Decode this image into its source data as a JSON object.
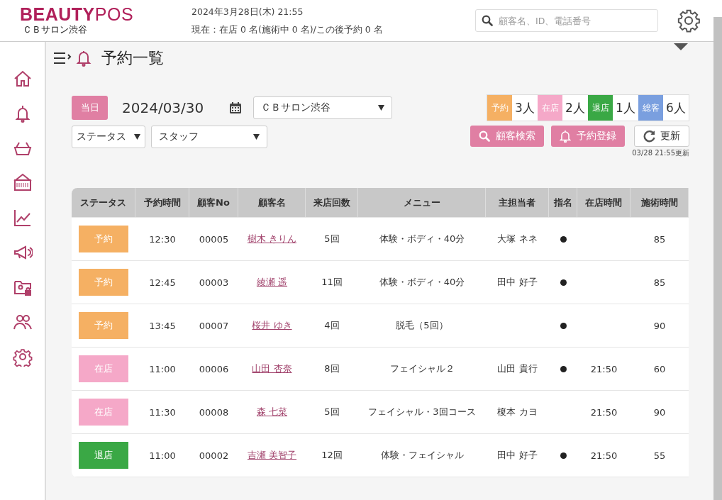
{
  "header": {
    "logo_bold": "BEAUTY",
    "logo_light": "POS",
    "salon": "ＣＢサロン渋谷",
    "datetime": "2024年3月28日(木) 21:55",
    "current": "現在：在店 0 名(施術中 0 名)/この後予約 0 名",
    "search": {
      "placeholder": "顧客名、ID、電話番号"
    }
  },
  "page_title": "予約一覧",
  "today_button": "当日",
  "date": "2024/03/30",
  "salon_select": "ＣＢサロン渋谷",
  "status_filter": "ステータス",
  "staff_filter": "スタッフ",
  "summary": [
    {
      "label": "予約",
      "count": "3人",
      "color": "#f5b063"
    },
    {
      "label": "在店",
      "count": "2人",
      "color": "#f5a8c8"
    },
    {
      "label": "退店",
      "count": "1人",
      "color": "#3aa845"
    },
    {
      "label": "総客",
      "count": "6人",
      "color": "#7a9fdf"
    }
  ],
  "buttons": {
    "customer_search": "顧客検索",
    "reserve": "予約登録",
    "refresh": "更新",
    "updated": "03/28 21:55更新"
  },
  "table": {
    "columns": [
      "ステータス",
      "予約時間",
      "顧客No",
      "顧客名",
      "来店回数",
      "メニュー",
      "主担当者",
      "指名",
      "在店時間",
      "施術時間"
    ],
    "rows": [
      {
        "status": "予約",
        "kind": "reserved",
        "time": "12:30",
        "no": "00005",
        "name": "樹木 きりん",
        "visits": "5回",
        "menu": "体験・ボディ・40分",
        "staff": "大塚 ネネ",
        "nominated": true,
        "in_time": "",
        "duration": "85"
      },
      {
        "status": "予約",
        "kind": "reserved",
        "time": "12:45",
        "no": "00003",
        "name": "綾瀬 遥",
        "visits": "11回",
        "menu": "体験・ボディ・40分",
        "staff": "田中 好子",
        "nominated": true,
        "in_time": "",
        "duration": "85"
      },
      {
        "status": "予約",
        "kind": "reserved",
        "time": "13:45",
        "no": "00007",
        "name": "桜井 ゆき",
        "visits": "4回",
        "menu": "脱毛（5回）",
        "staff": "",
        "nominated": true,
        "in_time": "",
        "duration": "90"
      },
      {
        "status": "在店",
        "kind": "in_store",
        "time": "11:00",
        "no": "00006",
        "name": "山田 杏奈",
        "visits": "8回",
        "menu": "フェイシャル２",
        "staff": "山田 貴行",
        "nominated": true,
        "in_time": "21:50",
        "duration": "60"
      },
      {
        "status": "在店",
        "kind": "in_store",
        "time": "11:30",
        "no": "00008",
        "name": "森 七菜",
        "visits": "5回",
        "menu": "フェイシャル・3回コース",
        "staff": "榎本 カヨ",
        "nominated": false,
        "in_time": "21:50",
        "duration": "90"
      },
      {
        "status": "退店",
        "kind": "left",
        "time": "11:00",
        "no": "00002",
        "name": "吉瀬 美智子",
        "visits": "12回",
        "menu": "体験・フェイシャル",
        "staff": "田中 好子",
        "nominated": true,
        "in_time": "21:50",
        "duration": "55"
      }
    ]
  }
}
